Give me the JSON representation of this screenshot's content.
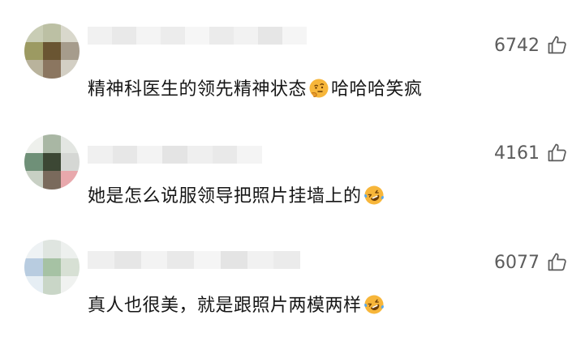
{
  "comments": [
    {
      "text_before": "精神科医生的领先精神状态",
      "emoji": "thinking-face-emoji",
      "text_after": "哈哈哈笑疯",
      "likes": "6742"
    },
    {
      "text_before": "她是怎么说服领导把照片挂墙上的",
      "emoji": "rolling-on-the-floor-laughing-emoji",
      "text_after": "",
      "likes": "4161"
    },
    {
      "text_before": "真人也很美，就是跟照片两模两样",
      "emoji": "rolling-on-the-floor-laughing-emoji",
      "text_after": "",
      "likes": "6077"
    }
  ],
  "colors": {
    "text": "#161616",
    "likes": "#5c5c5c",
    "emoji_yellow": "#f7b63a"
  }
}
